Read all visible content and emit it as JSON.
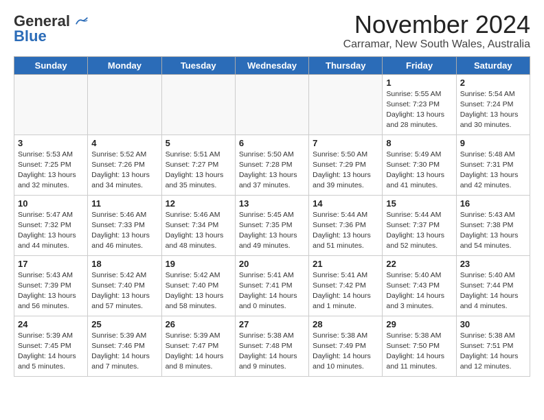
{
  "header": {
    "logo_general": "General",
    "logo_blue": "Blue",
    "title": "November 2024",
    "subtitle": "Carramar, New South Wales, Australia"
  },
  "weekdays": [
    "Sunday",
    "Monday",
    "Tuesday",
    "Wednesday",
    "Thursday",
    "Friday",
    "Saturday"
  ],
  "weeks": [
    [
      {
        "day": "",
        "info": "",
        "empty": true
      },
      {
        "day": "",
        "info": "",
        "empty": true
      },
      {
        "day": "",
        "info": "",
        "empty": true
      },
      {
        "day": "",
        "info": "",
        "empty": true
      },
      {
        "day": "",
        "info": "",
        "empty": true
      },
      {
        "day": "1",
        "info": "Sunrise: 5:55 AM\nSunset: 7:23 PM\nDaylight: 13 hours\nand 28 minutes.",
        "empty": false
      },
      {
        "day": "2",
        "info": "Sunrise: 5:54 AM\nSunset: 7:24 PM\nDaylight: 13 hours\nand 30 minutes.",
        "empty": false
      }
    ],
    [
      {
        "day": "3",
        "info": "Sunrise: 5:53 AM\nSunset: 7:25 PM\nDaylight: 13 hours\nand 32 minutes.",
        "empty": false
      },
      {
        "day": "4",
        "info": "Sunrise: 5:52 AM\nSunset: 7:26 PM\nDaylight: 13 hours\nand 34 minutes.",
        "empty": false
      },
      {
        "day": "5",
        "info": "Sunrise: 5:51 AM\nSunset: 7:27 PM\nDaylight: 13 hours\nand 35 minutes.",
        "empty": false
      },
      {
        "day": "6",
        "info": "Sunrise: 5:50 AM\nSunset: 7:28 PM\nDaylight: 13 hours\nand 37 minutes.",
        "empty": false
      },
      {
        "day": "7",
        "info": "Sunrise: 5:50 AM\nSunset: 7:29 PM\nDaylight: 13 hours\nand 39 minutes.",
        "empty": false
      },
      {
        "day": "8",
        "info": "Sunrise: 5:49 AM\nSunset: 7:30 PM\nDaylight: 13 hours\nand 41 minutes.",
        "empty": false
      },
      {
        "day": "9",
        "info": "Sunrise: 5:48 AM\nSunset: 7:31 PM\nDaylight: 13 hours\nand 42 minutes.",
        "empty": false
      }
    ],
    [
      {
        "day": "10",
        "info": "Sunrise: 5:47 AM\nSunset: 7:32 PM\nDaylight: 13 hours\nand 44 minutes.",
        "empty": false
      },
      {
        "day": "11",
        "info": "Sunrise: 5:46 AM\nSunset: 7:33 PM\nDaylight: 13 hours\nand 46 minutes.",
        "empty": false
      },
      {
        "day": "12",
        "info": "Sunrise: 5:46 AM\nSunset: 7:34 PM\nDaylight: 13 hours\nand 48 minutes.",
        "empty": false
      },
      {
        "day": "13",
        "info": "Sunrise: 5:45 AM\nSunset: 7:35 PM\nDaylight: 13 hours\nand 49 minutes.",
        "empty": false
      },
      {
        "day": "14",
        "info": "Sunrise: 5:44 AM\nSunset: 7:36 PM\nDaylight: 13 hours\nand 51 minutes.",
        "empty": false
      },
      {
        "day": "15",
        "info": "Sunrise: 5:44 AM\nSunset: 7:37 PM\nDaylight: 13 hours\nand 52 minutes.",
        "empty": false
      },
      {
        "day": "16",
        "info": "Sunrise: 5:43 AM\nSunset: 7:38 PM\nDaylight: 13 hours\nand 54 minutes.",
        "empty": false
      }
    ],
    [
      {
        "day": "17",
        "info": "Sunrise: 5:43 AM\nSunset: 7:39 PM\nDaylight: 13 hours\nand 56 minutes.",
        "empty": false
      },
      {
        "day": "18",
        "info": "Sunrise: 5:42 AM\nSunset: 7:40 PM\nDaylight: 13 hours\nand 57 minutes.",
        "empty": false
      },
      {
        "day": "19",
        "info": "Sunrise: 5:42 AM\nSunset: 7:40 PM\nDaylight: 13 hours\nand 58 minutes.",
        "empty": false
      },
      {
        "day": "20",
        "info": "Sunrise: 5:41 AM\nSunset: 7:41 PM\nDaylight: 14 hours\nand 0 minutes.",
        "empty": false
      },
      {
        "day": "21",
        "info": "Sunrise: 5:41 AM\nSunset: 7:42 PM\nDaylight: 14 hours\nand 1 minute.",
        "empty": false
      },
      {
        "day": "22",
        "info": "Sunrise: 5:40 AM\nSunset: 7:43 PM\nDaylight: 14 hours\nand 3 minutes.",
        "empty": false
      },
      {
        "day": "23",
        "info": "Sunrise: 5:40 AM\nSunset: 7:44 PM\nDaylight: 14 hours\nand 4 minutes.",
        "empty": false
      }
    ],
    [
      {
        "day": "24",
        "info": "Sunrise: 5:39 AM\nSunset: 7:45 PM\nDaylight: 14 hours\nand 5 minutes.",
        "empty": false
      },
      {
        "day": "25",
        "info": "Sunrise: 5:39 AM\nSunset: 7:46 PM\nDaylight: 14 hours\nand 7 minutes.",
        "empty": false
      },
      {
        "day": "26",
        "info": "Sunrise: 5:39 AM\nSunset: 7:47 PM\nDaylight: 14 hours\nand 8 minutes.",
        "empty": false
      },
      {
        "day": "27",
        "info": "Sunrise: 5:38 AM\nSunset: 7:48 PM\nDaylight: 14 hours\nand 9 minutes.",
        "empty": false
      },
      {
        "day": "28",
        "info": "Sunrise: 5:38 AM\nSunset: 7:49 PM\nDaylight: 14 hours\nand 10 minutes.",
        "empty": false
      },
      {
        "day": "29",
        "info": "Sunrise: 5:38 AM\nSunset: 7:50 PM\nDaylight: 14 hours\nand 11 minutes.",
        "empty": false
      },
      {
        "day": "30",
        "info": "Sunrise: 5:38 AM\nSunset: 7:51 PM\nDaylight: 14 hours\nand 12 minutes.",
        "empty": false
      }
    ]
  ]
}
